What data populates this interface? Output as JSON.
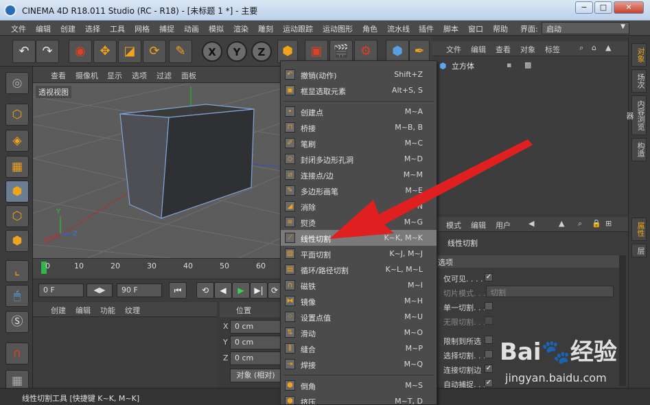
{
  "window": {
    "title": "CINEMA 4D R18.011 Studio (RC - R18) - [未标题 1 *] - 主要",
    "minimize_label": "−",
    "maximize_label": "□",
    "close_label": "✕"
  },
  "menubar": {
    "items": [
      "文件",
      "编辑",
      "创建",
      "选择",
      "工具",
      "网格",
      "捕捉",
      "动画",
      "模拟",
      "渲染",
      "雕刻",
      "运动跟踪",
      "运动图形",
      "角色",
      "流水线",
      "插件",
      "脚本",
      "窗口",
      "帮助"
    ],
    "layout_label": "界面:",
    "layout_value": "启动"
  },
  "toolbar": {
    "axis_x": "X",
    "axis_y": "Y",
    "axis_z": "Z"
  },
  "viewport": {
    "menus": [
      "查看",
      "摄像机",
      "显示",
      "选项",
      "过滤",
      "面板"
    ],
    "label": "透视视图",
    "axis_x": "X",
    "axis_y": "Y",
    "axis_z": "Z"
  },
  "timeline": {
    "ticks": [
      "0",
      "10",
      "20",
      "30",
      "40",
      "50",
      "60"
    ],
    "start_frame": "0 F",
    "end_frame": "90 F"
  },
  "materials": {
    "menus": [
      "创建",
      "编辑",
      "功能",
      "纹理"
    ]
  },
  "coordinates": {
    "header": "位置",
    "x_label": "X",
    "x_value": "0 cm",
    "y_label": "Y",
    "y_value": "0 cm",
    "z_label": "Z",
    "z_value": "0 cm",
    "mode_button": "对象 (相对)"
  },
  "object_manager": {
    "menus": [
      "文件",
      "编辑",
      "查看",
      "对象",
      "标签"
    ],
    "object_name": "立方体"
  },
  "attributes": {
    "menus": [
      "模式",
      "编辑",
      "用户"
    ],
    "tool_name": "线性切割",
    "section": "选项",
    "rows": [
      {
        "label": "仅可见. . . . .",
        "checked": true,
        "dim": false
      },
      {
        "label": "切片模式. . .",
        "value": "切割",
        "dim": true
      },
      {
        "label": "单一切割. . .",
        "checked": false,
        "dim": false
      },
      {
        "label": "无限切割. . .",
        "checked": false,
        "dim": true
      },
      {
        "label": "限制到所选",
        "checked": false,
        "dim": false
      },
      {
        "label": "选择切割. . .",
        "checked": false,
        "dim": false
      },
      {
        "label": "连接切割边",
        "checked": true,
        "dim": false
      },
      {
        "label": "自动捕捉. . .",
        "checked": true,
        "dim": false
      }
    ]
  },
  "side_tabs": [
    "对象",
    "场次",
    "内容浏览器",
    "构造",
    "属性",
    "层"
  ],
  "context_menu": {
    "items": [
      {
        "label": "撤销(动作)",
        "shortcut": "Shift+Z"
      },
      {
        "label": "框显选取元素",
        "shortcut": "Alt+S, S"
      },
      {
        "label": "创建点",
        "shortcut": "M~A"
      },
      {
        "label": "桥接",
        "shortcut": "M~B, B"
      },
      {
        "label": "笔刷",
        "shortcut": "M~C"
      },
      {
        "label": "封闭多边形孔洞",
        "shortcut": "M~D"
      },
      {
        "label": "连接点/边",
        "shortcut": "M~M"
      },
      {
        "label": "多边形画笔",
        "shortcut": "M~E"
      },
      {
        "label": "消除",
        "shortcut": "M~N"
      },
      {
        "label": "熨烫",
        "shortcut": "M~G"
      },
      {
        "label": "线性切割",
        "shortcut": "K~K, M~K",
        "highlighted": true
      },
      {
        "label": "平面切割",
        "shortcut": "K~J, M~J"
      },
      {
        "label": "循环/路径切割",
        "shortcut": "K~L, M~L"
      },
      {
        "label": "磁铁",
        "shortcut": "M~I"
      },
      {
        "label": "镜像",
        "shortcut": "M~H"
      },
      {
        "label": "设置点值",
        "shortcut": "M~U"
      },
      {
        "label": "滑动",
        "shortcut": "M~O"
      },
      {
        "label": "缝合",
        "shortcut": "M~P"
      },
      {
        "label": "焊接",
        "shortcut": "M~Q"
      },
      {
        "label": "倒角",
        "shortcut": "M~S"
      },
      {
        "label": "挤压",
        "shortcut": "M~T, D"
      }
    ]
  },
  "statusbar": {
    "text": "线性切割工具 [快捷键 K~K, M~K]"
  },
  "watermark": {
    "logo": "Bai🐾经验",
    "url": "jingyan.baidu.com"
  },
  "colors": {
    "accent": "#f0a31c",
    "arrow": "#e02020",
    "highlight": "#7a7a7a"
  }
}
